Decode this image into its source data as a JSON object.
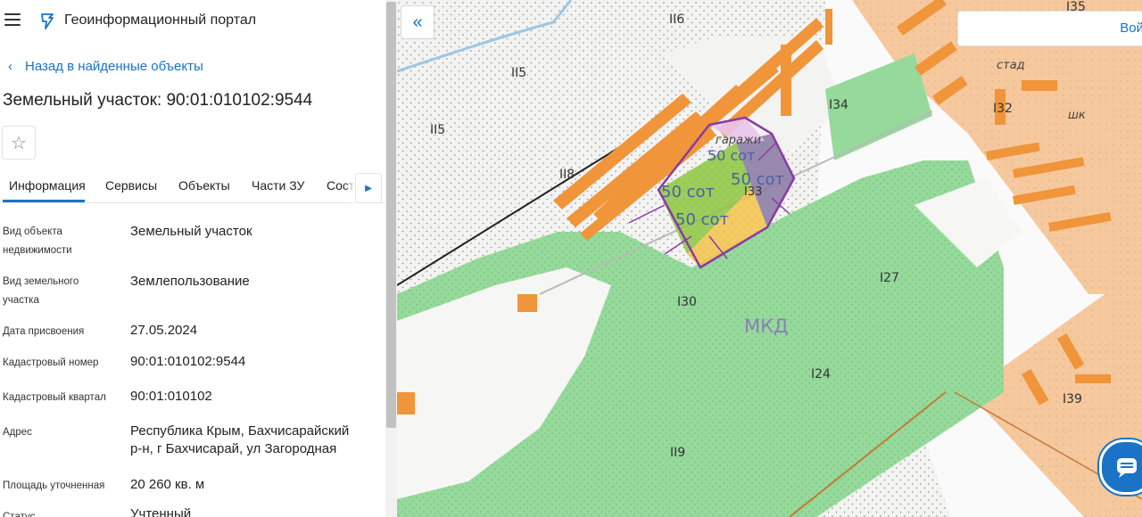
{
  "app": {
    "title": "Геоинформационный портал"
  },
  "nav": {
    "back_label": "Назад в найденные объекты"
  },
  "object": {
    "title": "Земельный участок: 90:01:010102:9544"
  },
  "tabs": [
    {
      "label": "Информация"
    },
    {
      "label": "Сервисы"
    },
    {
      "label": "Объекты"
    },
    {
      "label": "Части ЗУ"
    },
    {
      "label": "Соста"
    }
  ],
  "details": [
    {
      "label_lines": [
        "Вид объекта",
        "недвижимости"
      ],
      "value": "Земельный участок"
    },
    {
      "label_lines": [
        "Вид земельного",
        "участка"
      ],
      "value": "Землепользование"
    },
    {
      "label_lines": [
        "Дата присвоения"
      ],
      "value": "27.05.2024"
    },
    {
      "label_lines": [
        "Кадастровый номер"
      ],
      "value": "90:01:010102:9544"
    },
    {
      "label_lines": [
        "Кадастровый квартал"
      ],
      "value": "90:01:010102"
    },
    {
      "label_lines": [
        "Адрес"
      ],
      "value_lines": [
        "Республика Крым, Бахчисарайский",
        "р-н, г Бахчисарай, ул Загородная"
      ]
    },
    {
      "label_lines": [
        "Площадь уточненная"
      ],
      "value": "20 260 кв. м"
    },
    {
      "label_lines": [
        "Статус"
      ],
      "value": "Учтенный"
    }
  ],
  "map": {
    "search_label": "Вой",
    "zone_labels": [
      "II6",
      "II5",
      "II5",
      "II8",
      "I34",
      "I32",
      "I35",
      "I33",
      "I27",
      "I30",
      "I24",
      "I39",
      "II9"
    ],
    "place_labels": [
      "стад",
      "шк",
      "гаражи"
    ],
    "plot_labels": [
      "50 сот",
      "50 сот",
      "50 сот",
      "50 сот"
    ],
    "area_label": "МКД",
    "colors": {
      "forest": "#95da9a",
      "residential": "#f6c89e",
      "buildings": "#f0953a",
      "plot_outline": "#8a3aa8",
      "annotation": "#4b5ea8",
      "accent": "#1a73c7"
    }
  }
}
